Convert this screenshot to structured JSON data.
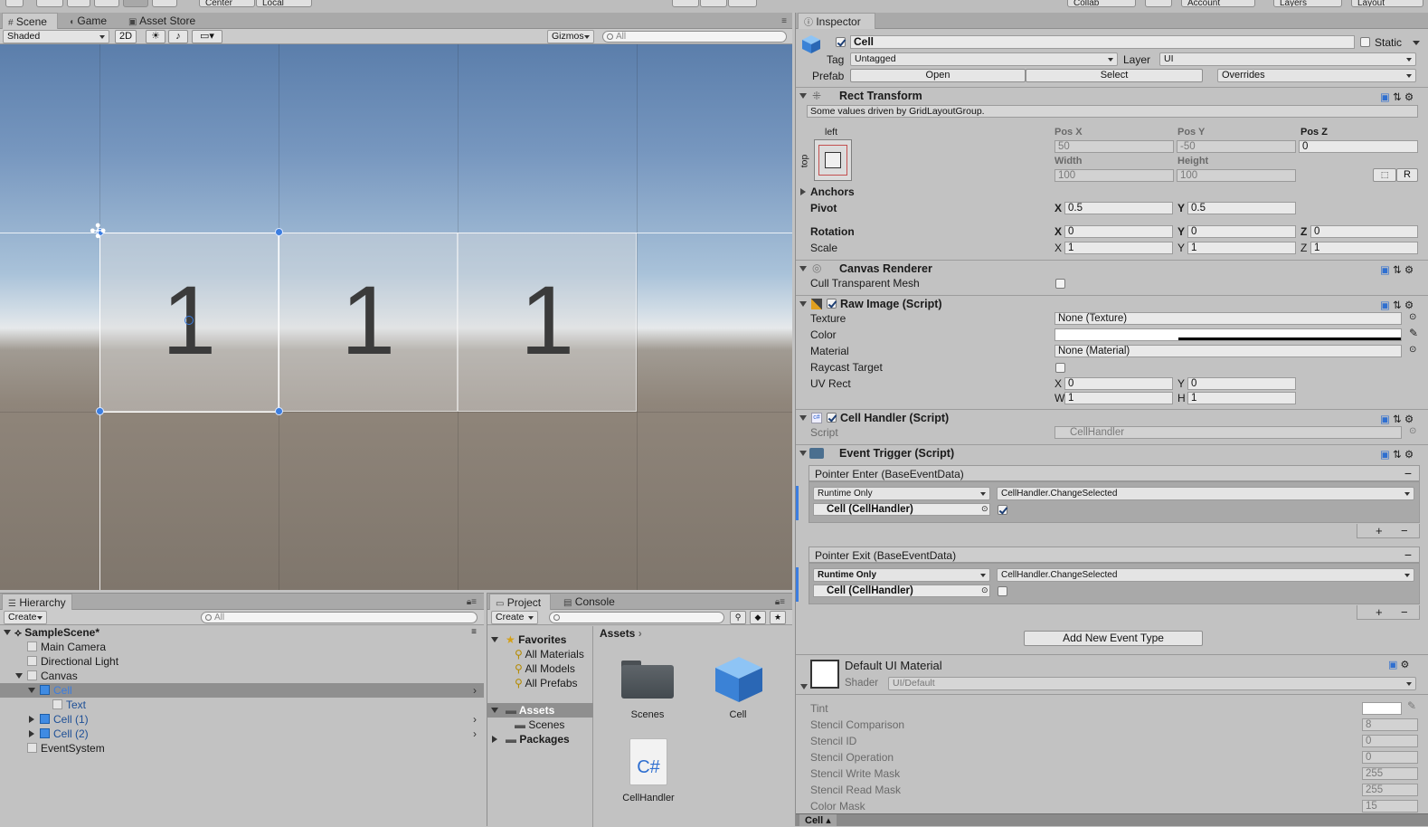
{
  "toolbar": {
    "center": "Center",
    "local": "Local",
    "collab": "Collab",
    "account": "Account",
    "layers": "Layers",
    "layout": "Layout"
  },
  "scene": {
    "tabs": [
      "Scene",
      "Game",
      "Asset Store"
    ],
    "shading": "Shaded",
    "mode_2d": "2D",
    "gizmos": "Gizmos",
    "search_placeholder": "All",
    "cells": [
      "1",
      "1",
      "1"
    ]
  },
  "hierarchy": {
    "tab": "Hierarchy",
    "create": "Create",
    "search_placeholder": "All",
    "items": [
      {
        "label": "SampleScene*"
      },
      {
        "label": "Main Camera"
      },
      {
        "label": "Directional Light"
      },
      {
        "label": "Canvas"
      },
      {
        "label": "Cell"
      },
      {
        "label": "Text"
      },
      {
        "label": "Cell (1)"
      },
      {
        "label": "Cell (2)"
      },
      {
        "label": "EventSystem"
      }
    ]
  },
  "project": {
    "tabs": [
      "Project",
      "Console"
    ],
    "create": "Create",
    "favorites": "Favorites",
    "fav_items": [
      "All Materials",
      "All Models",
      "All Prefabs"
    ],
    "assets": "Assets",
    "scenes": "Scenes",
    "packages": "Packages",
    "breadcrumb": "Assets",
    "files": [
      {
        "name": "Scenes",
        "icon": "folder-icon"
      },
      {
        "name": "Cell",
        "icon": "prefab-cube-icon"
      },
      {
        "name": "CellHandler",
        "icon": "csharp-script-icon"
      }
    ],
    "cs_glyph": "C#"
  },
  "inspector": {
    "tab": "Inspector",
    "object_name": "Cell",
    "static": "Static",
    "tag_label": "Tag",
    "tag": "Untagged",
    "layer_label": "Layer",
    "layer": "UI",
    "prefab_label": "Prefab",
    "open": "Open",
    "select": "Select",
    "overrides": "Overrides",
    "rect": {
      "title": "Rect Transform",
      "note": "Some values driven by GridLayoutGroup.",
      "anchor_h": "left",
      "anchor_v": "top",
      "posx_l": "Pos X",
      "posy_l": "Pos Y",
      "posz_l": "Pos Z",
      "posx": "50",
      "posy": "-50",
      "posz": "0",
      "width_l": "Width",
      "height_l": "Height",
      "width": "100",
      "height": "100",
      "r_btn": "R",
      "anchors": "Anchors",
      "pivot": "Pivot",
      "pivot_x": "0.5",
      "pivot_y": "0.5",
      "rotation": "Rotation",
      "rot_x": "0",
      "rot_y": "0",
      "rot_z": "0",
      "scale": "Scale",
      "sc_x": "1",
      "sc_y": "1",
      "sc_z": "1",
      "x": "X",
      "y": "Y",
      "z": "Z"
    },
    "canvas_renderer": {
      "title": "Canvas Renderer",
      "cull": "Cull Transparent Mesh"
    },
    "raw_image": {
      "title": "Raw Image (Script)",
      "texture_l": "Texture",
      "texture": "None (Texture)",
      "color_l": "Color",
      "material_l": "Material",
      "material": "None (Material)",
      "raycast": "Raycast Target",
      "uv": "UV Rect",
      "uv_x": "0",
      "uv_y": "0",
      "uv_w": "1",
      "uv_h": "1",
      "w": "W",
      "h": "H"
    },
    "cell_handler": {
      "title": "Cell Handler (Script)",
      "script_l": "Script",
      "script": "CellHandler"
    },
    "event_trigger": {
      "title": "Event Trigger (Script)",
      "entries": [
        {
          "header": "Pointer Enter (BaseEventData)",
          "mode": "Runtime Only",
          "func": "CellHandler.ChangeSelected",
          "target": "Cell (CellHandler)",
          "arg": true
        },
        {
          "header": "Pointer Exit (BaseEventData)",
          "mode": "Runtime Only",
          "func": "CellHandler.ChangeSelected",
          "target": "Cell (CellHandler)",
          "arg": false
        }
      ],
      "add": "Add New Event Type",
      "plus": "+",
      "minus": "−"
    },
    "material": {
      "name": "Default UI Material",
      "shader_l": "Shader",
      "shader": "UI/Default",
      "props": [
        {
          "label": "Tint",
          "value": ""
        },
        {
          "label": "Stencil Comparison",
          "value": "8"
        },
        {
          "label": "Stencil ID",
          "value": "0"
        },
        {
          "label": "Stencil Operation",
          "value": "0"
        },
        {
          "label": "Stencil Write Mask",
          "value": "255"
        },
        {
          "label": "Stencil Read Mask",
          "value": "255"
        },
        {
          "label": "Color Mask",
          "value": "15"
        }
      ]
    },
    "footer_tab": "Cell"
  },
  "colors": {
    "accent": "#3b7de0",
    "selection": "#8f8f8f"
  }
}
